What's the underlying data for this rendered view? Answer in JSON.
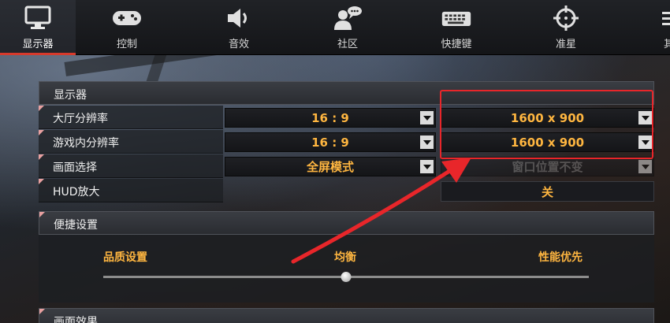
{
  "tabs": [
    {
      "label": "显示器",
      "icon": "monitor-icon",
      "active": true
    },
    {
      "label": "控制",
      "icon": "gamepad-icon",
      "active": false
    },
    {
      "label": "音效",
      "icon": "speaker-icon",
      "active": false
    },
    {
      "label": "社区",
      "icon": "community-chat-icon",
      "active": false
    },
    {
      "label": "快捷键",
      "icon": "keyboard-icon",
      "active": false
    },
    {
      "label": "准星",
      "icon": "crosshair-icon",
      "active": false
    },
    {
      "label": "其",
      "icon": "other-icon",
      "active": false
    }
  ],
  "display": {
    "title": "显示器",
    "rows": [
      {
        "label": "大厅分辨率",
        "ratio": "16 : 9",
        "resolution": "1600 x 900"
      },
      {
        "label": "游戏内分辨率",
        "ratio": "16 : 9",
        "resolution": "1600 x 900"
      },
      {
        "label": "画面选择",
        "mode": "全屏模式",
        "window_pos": "窗口位置不变"
      },
      {
        "label": "HUD放大",
        "value": "关"
      }
    ]
  },
  "quick": {
    "title": "便捷设置",
    "left_label": "品质设置",
    "mid_label": "均衡",
    "right_label": "性能优先",
    "slider_value": 0.5
  },
  "effects": {
    "title": "画面效果"
  },
  "colors": {
    "accent_orange": "#ffb640",
    "active_tab_red": "#d73a2c",
    "annotation_red": "#e8262a"
  }
}
